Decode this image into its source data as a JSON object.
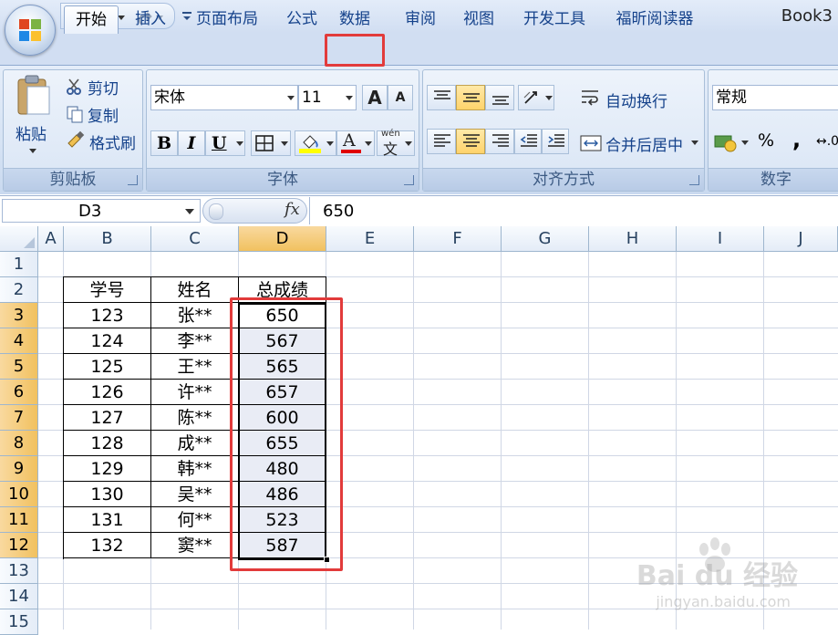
{
  "window": {
    "title": "Book3"
  },
  "tabs": [
    {
      "label": "开始",
      "active": true
    },
    {
      "label": "插入"
    },
    {
      "label": "页面布局"
    },
    {
      "label": "公式"
    },
    {
      "label": "数据",
      "highlighted": true
    },
    {
      "label": "审阅"
    },
    {
      "label": "视图"
    },
    {
      "label": "开发工具"
    },
    {
      "label": "福昕阅读器"
    }
  ],
  "clipboard": {
    "paste_label": "粘贴",
    "cut_label": "剪切",
    "copy_label": "复制",
    "format_painter_label": "格式刷",
    "group_label": "剪贴板"
  },
  "font": {
    "font_name": "宋体",
    "font_size": "11",
    "bold_glyph": "B",
    "italic_glyph": "I",
    "underline_glyph": "U",
    "grow_glyph": "A",
    "shrink_glyph": "A",
    "font_color_glyph": "A",
    "phonetic_glyph": "wén",
    "phonetic_char": "文",
    "group_label": "字体"
  },
  "alignment": {
    "wrap_text_label": "自动换行",
    "merge_center_label": "合并后居中",
    "group_label": "对齐方式"
  },
  "number": {
    "format": "常规",
    "percent_glyph": "%",
    "comma_glyph": ",",
    "increase_decimal_glyph": "↔.0",
    "group_label": "数字"
  },
  "formula_bar": {
    "name_box": "D3",
    "fx": "fx",
    "value": "650"
  },
  "columns": [
    "A",
    "B",
    "C",
    "D",
    "E",
    "F",
    "G",
    "H",
    "I",
    "J"
  ],
  "rows": [
    "1",
    "2",
    "3",
    "4",
    "5",
    "6",
    "7",
    "8",
    "9",
    "10",
    "11",
    "12",
    "13",
    "14",
    "15"
  ],
  "table": {
    "headers": [
      "学号",
      "姓名",
      "总成绩"
    ],
    "rows": [
      [
        "123",
        "张**",
        "650"
      ],
      [
        "124",
        "李**",
        "567"
      ],
      [
        "125",
        "王**",
        "565"
      ],
      [
        "126",
        "许**",
        "657"
      ],
      [
        "127",
        "陈**",
        "600"
      ],
      [
        "128",
        "成**",
        "655"
      ],
      [
        "129",
        "韩**",
        "480"
      ],
      [
        "130",
        "吴**",
        "486"
      ],
      [
        "131",
        "何**",
        "523"
      ],
      [
        "132",
        "窦**",
        "587"
      ]
    ]
  },
  "watermark": {
    "brand": "Bai du 经验",
    "url": "jingyan.baidu.com"
  },
  "colors": {
    "highlight_red": "#e23b3b",
    "selected_header": "#f1c15f",
    "ribbon_text": "#15428b"
  }
}
